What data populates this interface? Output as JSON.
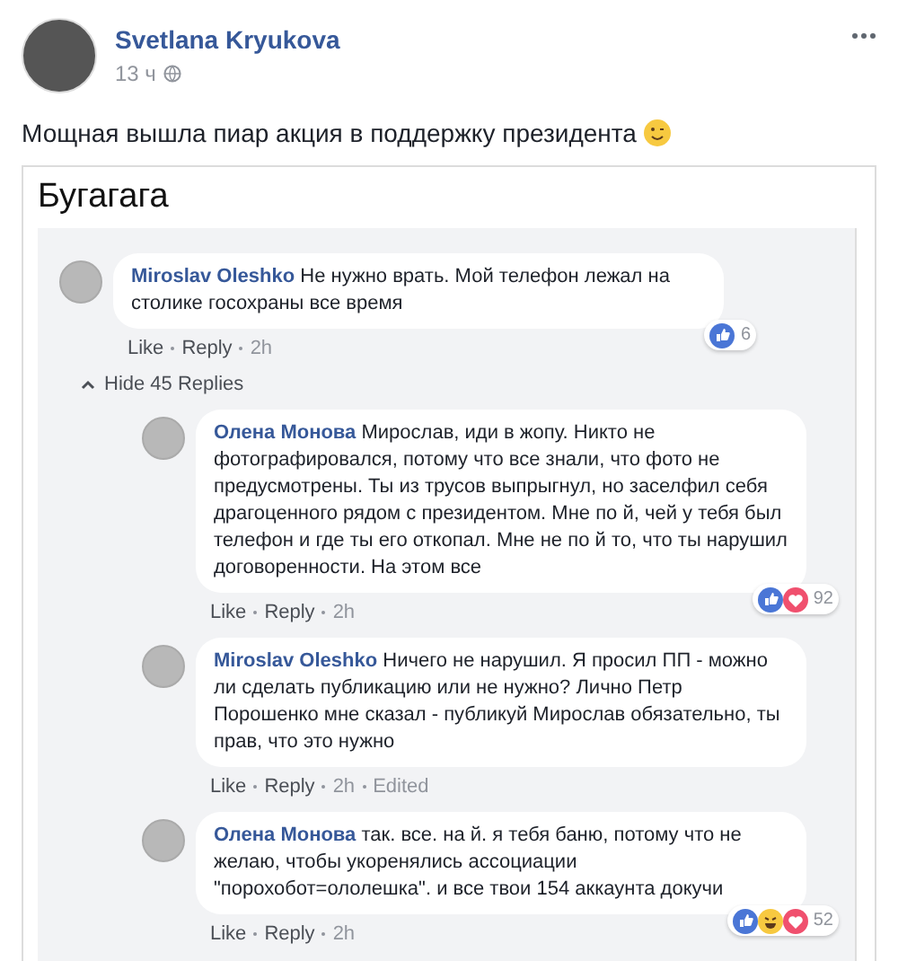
{
  "post": {
    "author": "Svetlana Kryukova",
    "time": "13 ч",
    "text": "Мощная вышла пиар акция в поддержку президента"
  },
  "screenshot": {
    "title": "Бугагага",
    "comments": [
      {
        "author": "Miroslav Oleshko",
        "text": "Не нужно врать. Мой телефон лежал на столике госохраны все время",
        "meta": [
          "Like",
          "Reply",
          "2h"
        ],
        "reactions": [
          {
            "kind": "like"
          }
        ],
        "count": "6",
        "reply": false
      },
      {
        "author": "Олена Монова",
        "text": "Мирослав, иди в жопу. Никто не фотографировался, потому что все знали, что фото не предусмотрены. Ты из трусов выпрыгнул, но заселфил себя драгоценного рядом с президентом. Мне по  й, чей у тебя был телефон и где ты его откопал. Мне не по  й то, что ты нарушил договоренности. На этом все",
        "meta": [
          "Like",
          "Reply",
          "2h"
        ],
        "reactions": [
          {
            "kind": "like"
          },
          {
            "kind": "love"
          }
        ],
        "count": "92",
        "reply": true
      },
      {
        "author": "Miroslav Oleshko",
        "text": "Ничего не нарушил. Я просил ПП - можно ли сделать публикацию или не нужно? Лично Петр Порошенко мне сказал - публикуй Мирослав обязательно, ты прав, что это нужно",
        "meta": [
          "Like",
          "Reply",
          "2h",
          "Edited"
        ],
        "reply": true
      },
      {
        "author": "Олена Монова",
        "text": "так. все. на  й. я тебя баню, потому что не желаю, чтобы укоренялись ассоциации \"порохобот=ололешка\". и все твои 154 аккаунта докучи",
        "meta": [
          "Like",
          "Reply",
          "2h"
        ],
        "reactions": [
          {
            "kind": "like"
          },
          {
            "kind": "haha"
          },
          {
            "kind": "love"
          }
        ],
        "count": "52",
        "reply": true
      }
    ],
    "toggle": {
      "label": "Hide 45 Replies"
    }
  }
}
